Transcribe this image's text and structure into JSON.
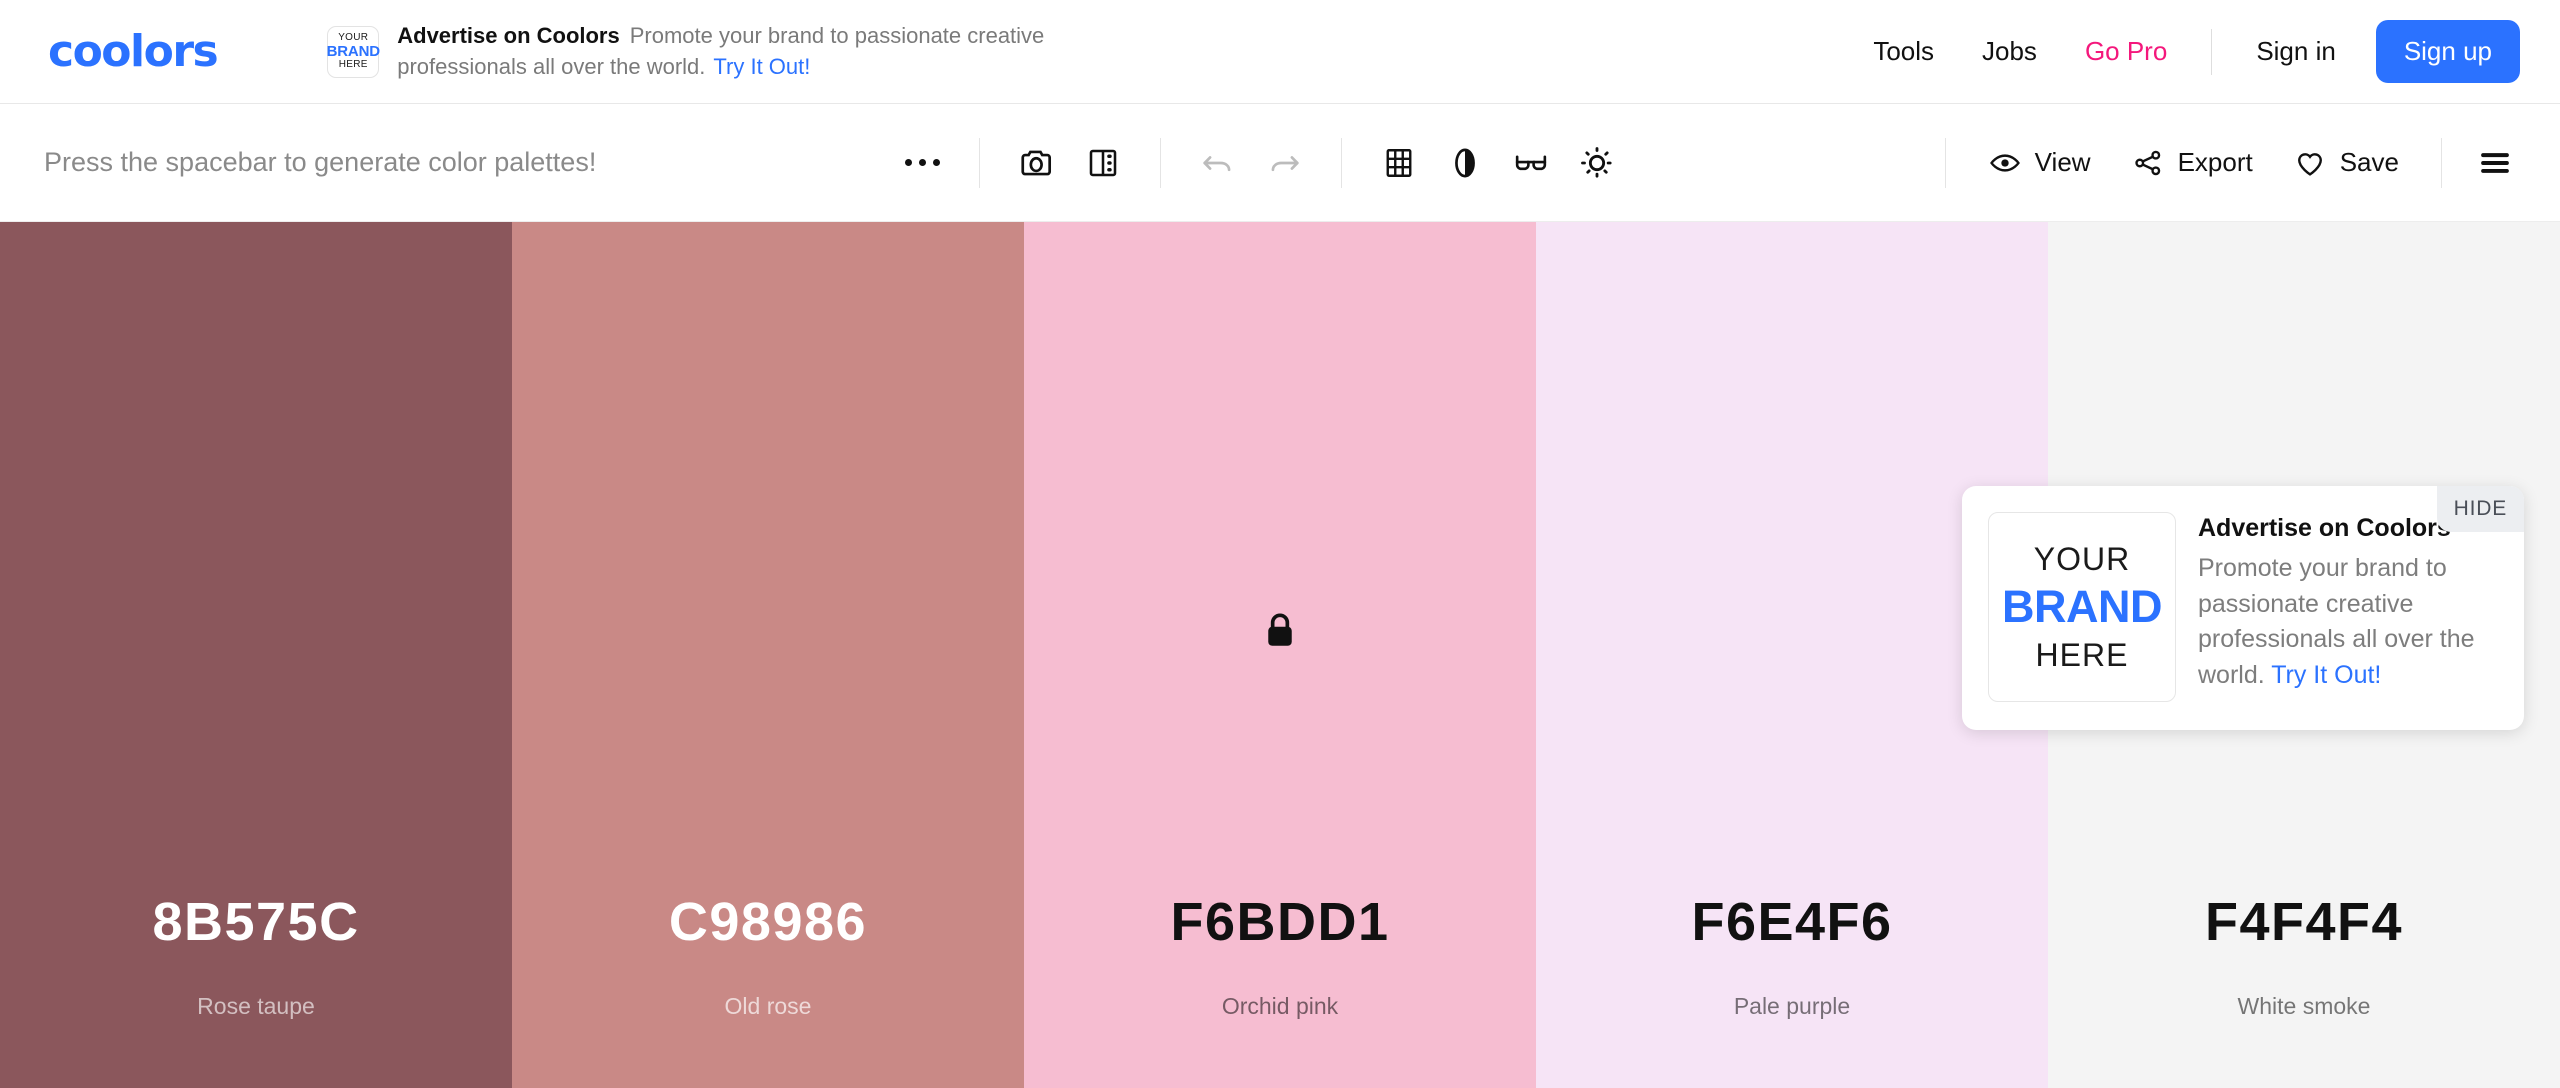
{
  "header": {
    "logo": "coolors",
    "ad": {
      "thumb_line1": "YOUR",
      "thumb_line2": "BRAND",
      "thumb_line3": "HERE",
      "title": "Advertise on Coolors",
      "description": "Promote your brand to passionate creative professionals all over the world.",
      "cta": "Try It Out!"
    },
    "nav": [
      {
        "label": "Tools",
        "style": "default"
      },
      {
        "label": "Jobs",
        "style": "default"
      },
      {
        "label": "Go Pro",
        "style": "pro"
      }
    ],
    "signin_label": "Sign in",
    "signup_label": "Sign up",
    "accent_blue": "#2B72FF",
    "pro_pink": "#F4187C"
  },
  "toolbar": {
    "hint": "Press the spacebar to generate color palettes!",
    "icons": [
      {
        "name": "more-options-icon",
        "label": "More options"
      },
      {
        "name": "camera-icon",
        "label": "Camera"
      },
      {
        "name": "split-view-icon",
        "label": "Split view"
      },
      {
        "name": "undo-icon",
        "label": "Undo",
        "disabled": true
      },
      {
        "name": "redo-icon",
        "label": "Redo",
        "disabled": true
      },
      {
        "name": "grid-icon",
        "label": "Grid"
      },
      {
        "name": "contrast-icon",
        "label": "Contrast checker"
      },
      {
        "name": "glasses-icon",
        "label": "Color blindness"
      },
      {
        "name": "brightness-icon",
        "label": "Adjust"
      }
    ],
    "view_label": "View",
    "export_label": "Export",
    "save_label": "Save",
    "menu_label": "Menu"
  },
  "palette": {
    "swatches": [
      {
        "hex": "8B575C",
        "color": "#8B575C",
        "name": "Rose taupe",
        "text_color": "#ffffff",
        "name_color": "rgba(255,255,255,0.62)",
        "locked": false
      },
      {
        "hex": "C98986",
        "color": "#C98986",
        "name": "Old rose",
        "text_color": "#ffffff",
        "name_color": "rgba(255,255,255,0.68)",
        "locked": false
      },
      {
        "hex": "F6BDD1",
        "color": "#F6BDD1",
        "name": "Orchid pink",
        "text_color": "#111111",
        "name_color": "rgba(0,0,0,0.52)",
        "locked": true
      },
      {
        "hex": "F6E4F6",
        "color": "#F6E4F6",
        "name": "Pale purple",
        "text_color": "#111111",
        "name_color": "rgba(0,0,0,0.52)",
        "locked": false
      },
      {
        "hex": "F4F4F4",
        "color": "#F4F4F4",
        "name": "White smoke",
        "text_color": "#111111",
        "name_color": "rgba(0,0,0,0.52)",
        "locked": false
      }
    ]
  },
  "ad_card": {
    "thumb_line1": "YOUR",
    "thumb_line2": "BRAND",
    "thumb_line3": "HERE",
    "title": "Advertise on Coolors",
    "description": "Promote your brand to passionate creative professionals all over the world.",
    "cta": "Try It Out!",
    "hide_label": "HIDE"
  }
}
